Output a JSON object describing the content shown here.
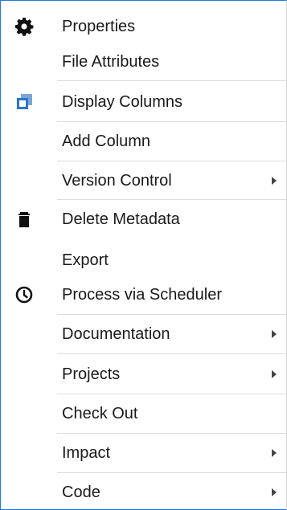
{
  "menu": {
    "items": [
      {
        "label": "Properties",
        "icon": "gear-icon"
      },
      {
        "label": "File Attributes"
      },
      {
        "label": "Display Columns",
        "icon": "display-columns-icon"
      },
      {
        "label": "Add Column"
      },
      {
        "label": "Version Control",
        "submenu": true
      },
      {
        "label": "Delete Metadata",
        "icon": "trash-icon"
      },
      {
        "label": "Export"
      },
      {
        "label": "Process via Scheduler",
        "icon": "clock-icon"
      },
      {
        "label": "Documentation",
        "submenu": true
      },
      {
        "label": "Projects",
        "submenu": true
      },
      {
        "label": "Check Out"
      },
      {
        "label": "Impact",
        "submenu": true
      },
      {
        "label": "Code",
        "submenu": true
      }
    ],
    "colors": {
      "accent_border": "#1f7ad6",
      "icon_blue": "#2a78c9",
      "text": "#1a1a1a",
      "separator": "#dcdcdc"
    }
  }
}
